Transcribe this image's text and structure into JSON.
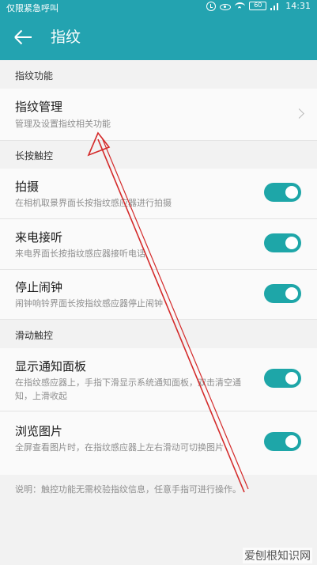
{
  "status_bar": {
    "carrier": "仅限紧急呼叫",
    "battery": "60",
    "time": "14:31"
  },
  "header": {
    "title": "指纹"
  },
  "sections": {
    "fingerprint_functions": "指纹功能",
    "long_press": "长按触控",
    "swipe": "滑动触控"
  },
  "items": {
    "manage": {
      "title": "指纹管理",
      "desc": "管理及设置指纹相关功能"
    },
    "photo": {
      "title": "拍摄",
      "desc": "在相机取景界面长按指纹感应器进行拍摄",
      "enabled": true
    },
    "answer_call": {
      "title": "来电接听",
      "desc": "来电界面长按指纹感应器接听电话",
      "enabled": true
    },
    "stop_alarm": {
      "title": "停止闹钟",
      "desc": "闹钟响铃界面长按指纹感应器停止闹钟",
      "enabled": true
    },
    "notification_panel": {
      "title": "显示通知面板",
      "desc": "在指纹感应器上，手指下滑显示系统通知面板，双击清空通知，上滑收起",
      "enabled": true
    },
    "browse_photos": {
      "title": "浏览图片",
      "desc": "全屏查看图片时，在指纹感应器上左右滑动可切换图片",
      "enabled": true
    }
  },
  "footer": {
    "note": "说明：触控功能无需校验指纹信息，任意手指可进行操作。"
  },
  "watermark": "爱刨根知识网",
  "colors": {
    "accent": "#23a3b0",
    "toggle_on": "#1ea6a8",
    "annotation_arrow": "#d42a2a"
  }
}
